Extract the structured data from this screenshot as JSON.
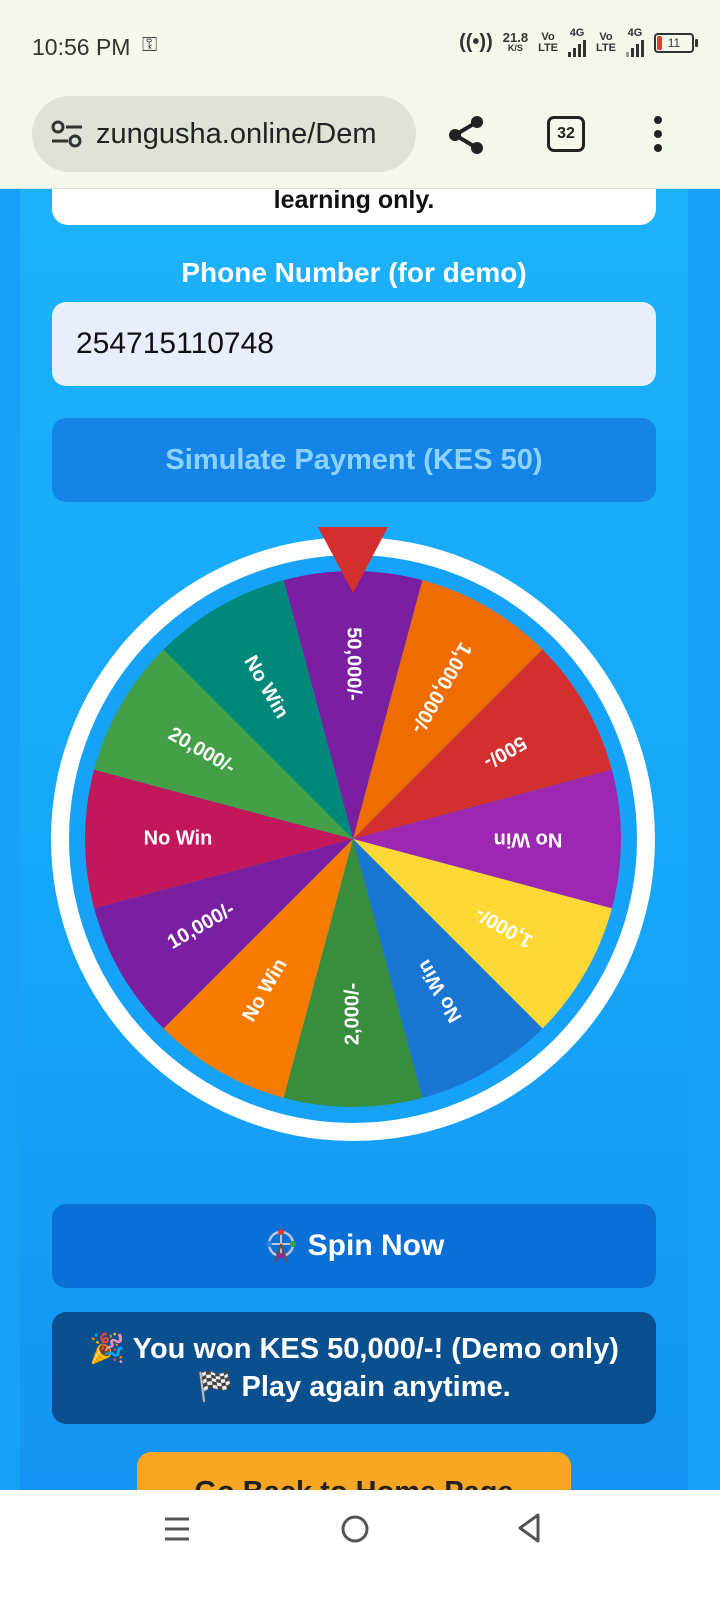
{
  "status_bar": {
    "time": "10:56 PM",
    "speed": "21.8",
    "speed_unit": "K/S",
    "sim1": {
      "top": "Vo",
      "bottom": "LTE",
      "network": "4G"
    },
    "sim2": {
      "top": "Vo",
      "bottom": "LTE",
      "network": "4G"
    },
    "battery": "11"
  },
  "browser": {
    "url": "zungusha.online/Dem",
    "tab_count": "32"
  },
  "page": {
    "disclaimer_tail": "learning only.",
    "phone_label": "Phone Number (for demo)",
    "phone_value": "254715110748",
    "pay_button": "Simulate Payment (KES 50)",
    "spin_button": "Spin Now",
    "result_line1": "🎉 You won KES 50,000/-! (Demo only)",
    "result_line2": "🏁 Play again anytime.",
    "home_button": "Go Back to Home Page"
  },
  "wheel": {
    "segments": [
      {
        "label": "50,000/-",
        "color": "#7b1fa2"
      },
      {
        "label": "1,000,000/-",
        "color": "#ef6c00"
      },
      {
        "label": "500/-",
        "color": "#d32f2f"
      },
      {
        "label": "No Win",
        "color": "#9c27b0"
      },
      {
        "label": "1,000/-",
        "color": "#fdd835"
      },
      {
        "label": "No Win",
        "color": "#1976d2"
      },
      {
        "label": "2,000/-",
        "color": "#388e3c"
      },
      {
        "label": "No Win",
        "color": "#f57c00"
      },
      {
        "label": "10,000/-",
        "color": "#7b1fa2"
      },
      {
        "label": "No Win",
        "color": "#c2185b"
      },
      {
        "label": "20,000/-",
        "color": "#43a047"
      },
      {
        "label": "No Win",
        "color": "#00897b"
      }
    ],
    "pointer_color": "#d32f2f",
    "rim_color": "#16a2f7"
  }
}
